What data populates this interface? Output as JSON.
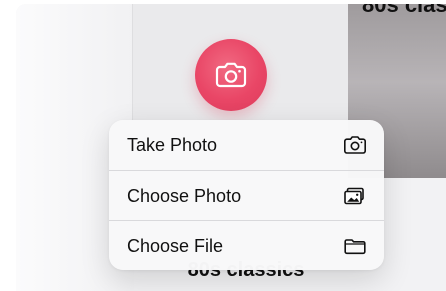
{
  "background": {
    "right_card_title": "80s clas",
    "album_title": "80s classics",
    "camera_button_color": "#e94666"
  },
  "menu": {
    "items": [
      {
        "label": "Take Photo",
        "icon": "camera-icon"
      },
      {
        "label": "Choose Photo",
        "icon": "photo-library-icon"
      },
      {
        "label": "Choose File",
        "icon": "folder-icon"
      }
    ]
  }
}
